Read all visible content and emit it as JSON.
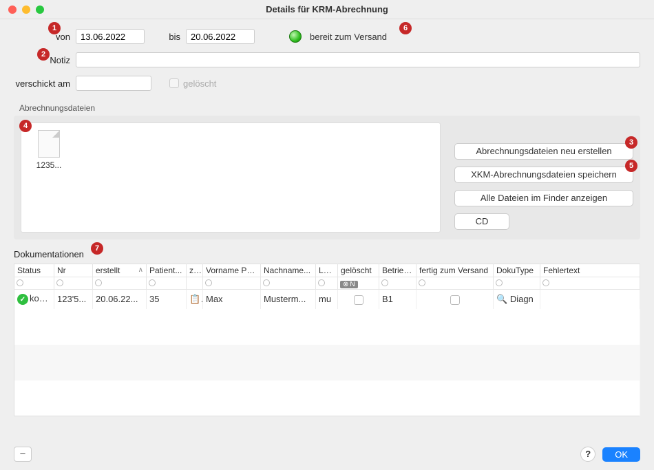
{
  "window_title": "Details für KRM-Abrechnung",
  "labels": {
    "von": "von",
    "bis": "bis",
    "notiz": "Notiz",
    "verschickt_am": "verschickt am",
    "geloescht": "gelöscht",
    "abrechnungsdateien": "Abrechnungsdateien",
    "dokumentationen": "Dokumentationen",
    "status_text": "bereit zum Versand"
  },
  "fields": {
    "von": "13.06.2022",
    "bis": "20.06.2022",
    "notiz": "",
    "verschickt_am": ""
  },
  "files": [
    {
      "name": "1235..."
    }
  ],
  "buttons": {
    "recreate": "Abrechnungsdateien neu erstellen",
    "xkm_save": "XKM-Abrechnungsdateien speichern",
    "show_finder": "Alle Dateien im Finder anzeigen",
    "cd": "CD",
    "ok": "OK",
    "help": "?",
    "minus": "–"
  },
  "table": {
    "columns": [
      "Status",
      "Nr",
      "erstellt",
      "Patient...",
      "z...",
      "Vorname Pa...",
      "Nachname...",
      "Lei...",
      "gelöscht",
      "Betrieb...",
      "fertig zum Versand",
      "DokuType",
      "Fehlertext"
    ],
    "filter_geloescht": "N",
    "rows": [
      {
        "status": "komp",
        "nr": "123'5...",
        "erstellt": "20.06.22...",
        "patient": "35",
        "z": "📋",
        "vorname": "Max",
        "nachname": "Musterm...",
        "lei": "mu",
        "geloescht": false,
        "betrieb": "B1",
        "fertig": false,
        "dokutype_icon": "🔍",
        "dokutype": "Diagn",
        "fehlertext": ""
      }
    ]
  },
  "badges": {
    "b1": "1",
    "b2": "2",
    "b3": "3",
    "b4": "4",
    "b5": "5",
    "b6": "6",
    "b7": "7"
  }
}
